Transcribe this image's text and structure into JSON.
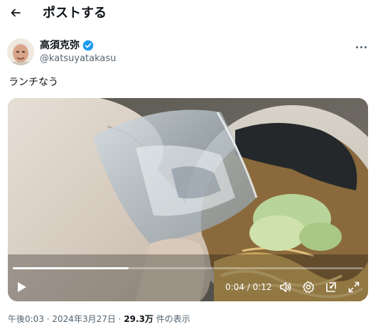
{
  "header": {
    "title": "ポストする",
    "back_icon": "arrow-left-icon"
  },
  "author": {
    "name": "高須克弥",
    "handle": "@katsuyatakasu",
    "verified": true,
    "verified_color": "#1d9bf0"
  },
  "post": {
    "text": "ランチなう"
  },
  "video": {
    "elapsed": "0:04",
    "separator": " / ",
    "duration": "0:12",
    "progress": 0.33,
    "controls": [
      "play-icon",
      "volume-icon",
      "settings-icon",
      "picture-in-picture-icon",
      "fullscreen-icon"
    ]
  },
  "meta": {
    "time": "午後0:03",
    "dot1": " · ",
    "date": "2024年3月27日",
    "dot2": " · ",
    "views_count": "29.3万",
    "views_label": " 件の表示"
  }
}
